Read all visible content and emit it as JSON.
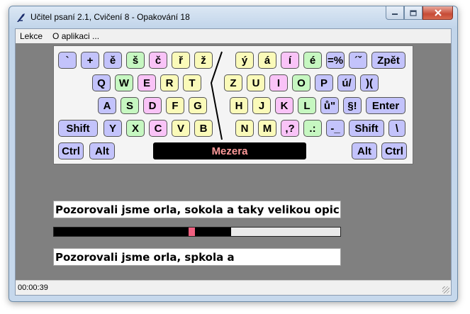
{
  "window": {
    "title": "Učitel psaní 2.1, Cvičení 8 - Opakování 18",
    "controls": {
      "minimize_icon": "minimize-icon",
      "maximize_icon": "maximize-icon",
      "close_icon": "close-icon"
    }
  },
  "menu": {
    "items": [
      {
        "label": "Lekce"
      },
      {
        "label": "O aplikaci ..."
      }
    ]
  },
  "colors": {
    "key_blue": "#c3c3fb",
    "key_green": "#c6f7c1",
    "key_pink": "#f9c3f7",
    "key_yellow": "#fafab9",
    "space_text": "#ff9a9a",
    "progress_marker": "#f06080",
    "canvas": "#808080"
  },
  "keyboard": {
    "keys": [
      {
        "id": "backtick",
        "label": "`",
        "color": "blue"
      },
      {
        "id": "plus",
        "label": "+",
        "color": "blue"
      },
      {
        "id": "e-caron",
        "label": "ě",
        "color": "blue"
      },
      {
        "id": "s-caron",
        "label": "š",
        "color": "green"
      },
      {
        "id": "c-caron",
        "label": "č",
        "color": "pink"
      },
      {
        "id": "r-caron",
        "label": "ř",
        "color": "yellow"
      },
      {
        "id": "z-caron",
        "label": "ž",
        "color": "yellow"
      },
      {
        "id": "y-acute",
        "label": "ý",
        "color": "yellow"
      },
      {
        "id": "a-acute",
        "label": "á",
        "color": "yellow"
      },
      {
        "id": "i-acute",
        "label": "í",
        "color": "pink"
      },
      {
        "id": "e-acute",
        "label": "é",
        "color": "green"
      },
      {
        "id": "equals-percent",
        "label": "=%",
        "color": "blue"
      },
      {
        "id": "acute-caron",
        "label": "´ˇ",
        "color": "blue"
      },
      {
        "id": "backspace",
        "label": "Zpět",
        "color": "blue"
      },
      {
        "id": "q",
        "label": "Q",
        "color": "blue"
      },
      {
        "id": "w",
        "label": "W",
        "color": "green"
      },
      {
        "id": "e",
        "label": "E",
        "color": "pink"
      },
      {
        "id": "r",
        "label": "R",
        "color": "yellow"
      },
      {
        "id": "t",
        "label": "T",
        "color": "yellow"
      },
      {
        "id": "z",
        "label": "Z",
        "color": "yellow"
      },
      {
        "id": "u",
        "label": "U",
        "color": "yellow"
      },
      {
        "id": "i",
        "label": "I",
        "color": "pink"
      },
      {
        "id": "o",
        "label": "O",
        "color": "green"
      },
      {
        "id": "p",
        "label": "P",
        "color": "blue"
      },
      {
        "id": "u-acute",
        "label": "ú/",
        "color": "blue"
      },
      {
        "id": "paren",
        "label": ")(",
        "color": "blue"
      },
      {
        "id": "a",
        "label": "A",
        "color": "blue"
      },
      {
        "id": "s",
        "label": "S",
        "color": "green"
      },
      {
        "id": "d",
        "label": "D",
        "color": "pink"
      },
      {
        "id": "f",
        "label": "F",
        "color": "yellow"
      },
      {
        "id": "g",
        "label": "G",
        "color": "yellow"
      },
      {
        "id": "h",
        "label": "H",
        "color": "yellow"
      },
      {
        "id": "j",
        "label": "J",
        "color": "yellow"
      },
      {
        "id": "k",
        "label": "K",
        "color": "pink"
      },
      {
        "id": "l",
        "label": "L",
        "color": "green"
      },
      {
        "id": "u-ring",
        "label": "ů\"",
        "color": "blue"
      },
      {
        "id": "section",
        "label": "§!",
        "color": "blue"
      },
      {
        "id": "enter",
        "label": "Enter",
        "color": "blue"
      },
      {
        "id": "shift-left",
        "label": "Shift",
        "color": "blue"
      },
      {
        "id": "y",
        "label": "Y",
        "color": "blue"
      },
      {
        "id": "x",
        "label": "X",
        "color": "green"
      },
      {
        "id": "c",
        "label": "C",
        "color": "pink"
      },
      {
        "id": "v",
        "label": "V",
        "color": "yellow"
      },
      {
        "id": "b",
        "label": "B",
        "color": "yellow"
      },
      {
        "id": "n",
        "label": "N",
        "color": "yellow"
      },
      {
        "id": "m",
        "label": "M",
        "color": "yellow"
      },
      {
        "id": "comma",
        "label": ",?",
        "color": "pink"
      },
      {
        "id": "period",
        "label": ".:",
        "color": "green"
      },
      {
        "id": "minus",
        "label": "-_",
        "color": "blue"
      },
      {
        "id": "shift-right",
        "label": "Shift",
        "color": "blue"
      },
      {
        "id": "backslash",
        "label": "\\",
        "color": "blue"
      },
      {
        "id": "ctrl-left",
        "label": "Ctrl",
        "color": "blue"
      },
      {
        "id": "alt-left",
        "label": "Alt",
        "color": "blue"
      },
      {
        "id": "space",
        "label": "Mezera",
        "color": "space"
      },
      {
        "id": "alt-right",
        "label": "Alt",
        "color": "blue"
      },
      {
        "id": "ctrl-right",
        "label": "Ctrl",
        "color": "blue"
      }
    ]
  },
  "exercise": {
    "target_text": "Pozorovali jsme orla, sokola a taky velikou opici.",
    "typed_text": "Pozorovali jsme orla, spkola a",
    "progress_fraction": 0.62,
    "marker_fraction": 0.47
  },
  "status": {
    "elapsed": "00:00:39"
  }
}
